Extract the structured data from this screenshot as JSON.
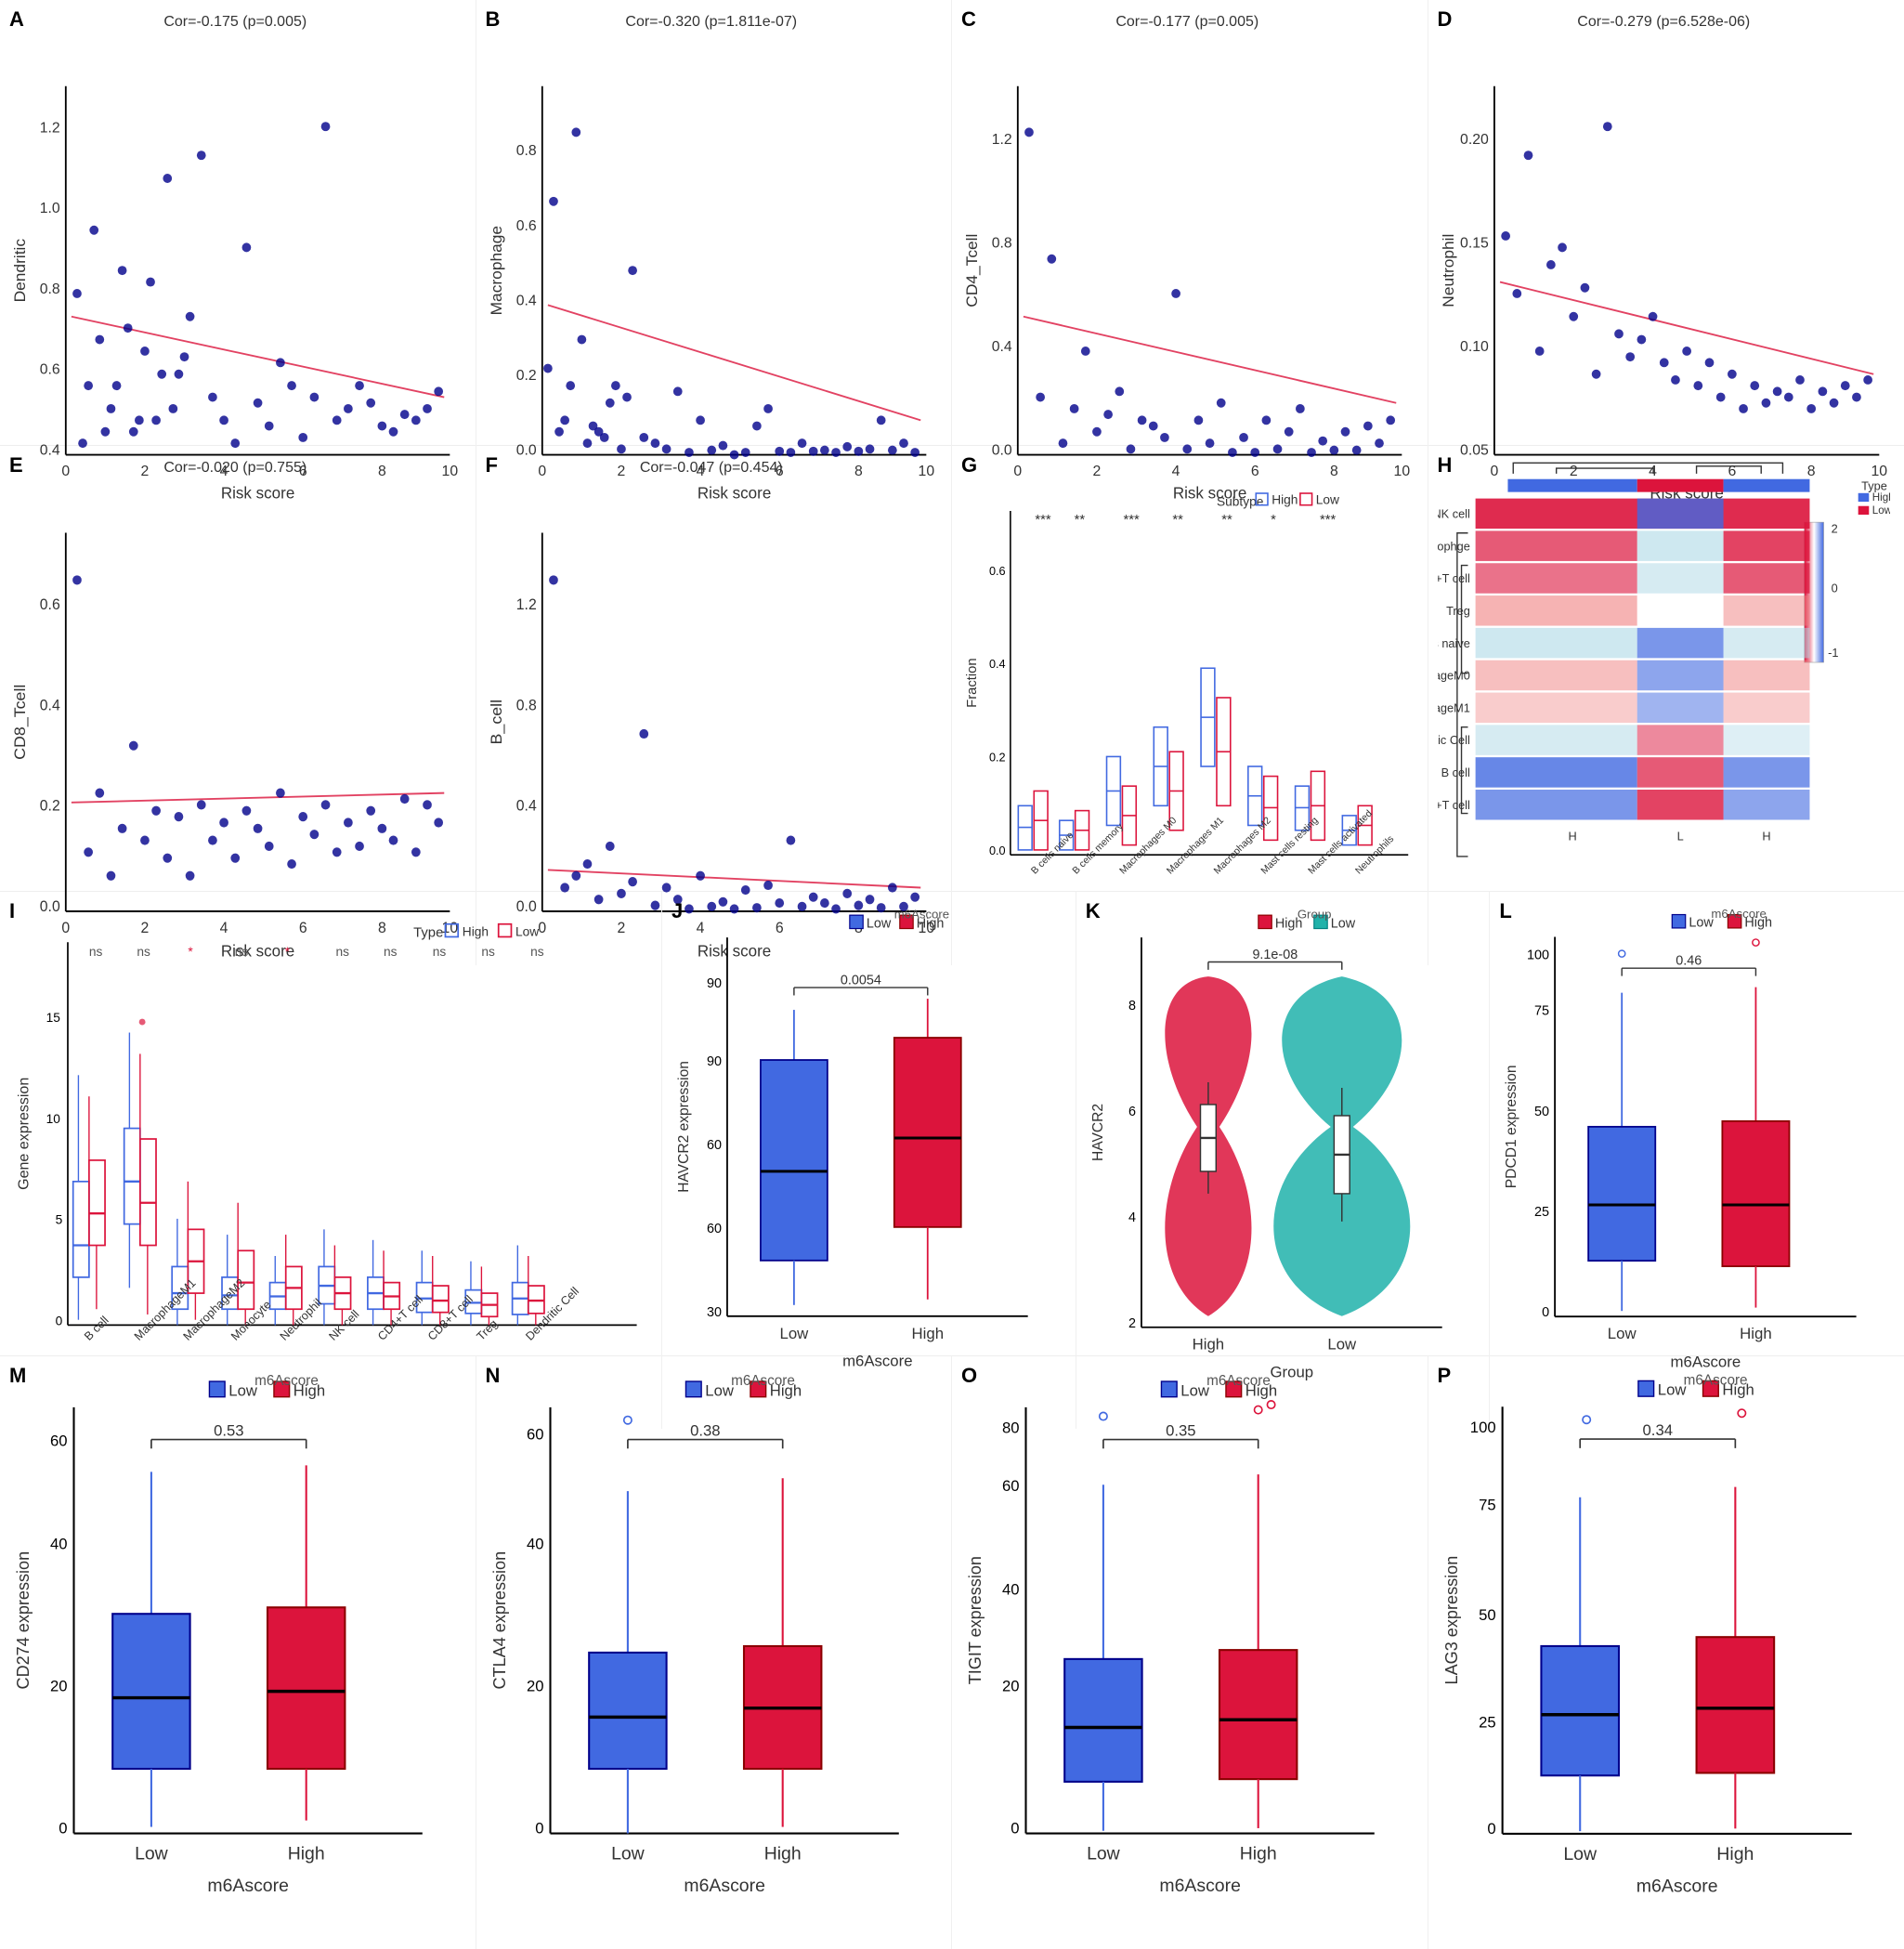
{
  "panels": {
    "A": {
      "label": "A",
      "title": "Cor=-0.175 (p=0.005)",
      "yLabel": "Dendritic",
      "xLabel": "Risk score"
    },
    "B": {
      "label": "B",
      "title": "Cor=-0.320 (p=1.811e-07)",
      "yLabel": "Macrophage",
      "xLabel": "Risk score"
    },
    "C": {
      "label": "C",
      "title": "Cor=-0.177 (p=0.005)",
      "yLabel": "CD4_Tcell",
      "xLabel": "Risk score"
    },
    "D": {
      "label": "D",
      "title": "Cor=-0.279 (p=6.528e-06)",
      "yLabel": "Neutrophil",
      "xLabel": "Risk score"
    },
    "E": {
      "label": "E",
      "title": "Cor=-0.020 (p=0.755)",
      "yLabel": "CD8_Tcell",
      "xLabel": "Risk score"
    },
    "F": {
      "label": "F",
      "title": "Cor=-0.047 (p=0.454)",
      "yLabel": "B_cell",
      "xLabel": "Risk score"
    },
    "G": {
      "label": "G",
      "title": "",
      "yLabel": "Fraction",
      "xLabel": ""
    },
    "H": {
      "label": "H",
      "title": "",
      "yLabel": "",
      "xLabel": ""
    },
    "I": {
      "label": "I",
      "title": "",
      "yLabel": "Gene expression",
      "xLabel": ""
    },
    "J": {
      "label": "J",
      "title": "0.0054",
      "yLabel": "HAVCR2 expression",
      "xLabel": "m6Ascore"
    },
    "K": {
      "label": "K",
      "title": "9.1e-08",
      "yLabel": "HAVCR2",
      "xLabel": "Group"
    },
    "L": {
      "label": "L",
      "title": "0.46",
      "yLabel": "PDCD1 expression",
      "xLabel": "m6Ascore"
    },
    "M": {
      "label": "M",
      "title": "0.53",
      "yLabel": "CD274 expression",
      "xLabel": "m6Ascore"
    },
    "N": {
      "label": "N",
      "title": "0.38",
      "yLabel": "CTLA4 expression",
      "xLabel": "m6Ascore"
    },
    "O": {
      "label": "O",
      "title": "0.35",
      "yLabel": "TIGIT expression",
      "xLabel": "m6Ascore"
    },
    "P": {
      "label": "P",
      "title": "0.34",
      "yLabel": "LAG3 expression",
      "xLabel": "m6Ascore"
    }
  },
  "colors": {
    "blue": "#4169E1",
    "red": "#DC143C",
    "teal": "#20B2AA",
    "pink": "#FF69B4",
    "darkblue": "#00008B",
    "lightblue": "#ADD8E6"
  }
}
